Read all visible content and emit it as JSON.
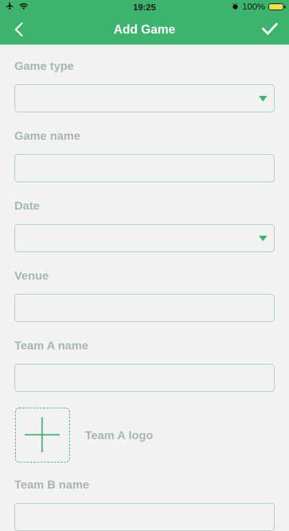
{
  "status_bar": {
    "time": "19:25",
    "battery": "100%"
  },
  "nav": {
    "title": "Add Game",
    "back_icon": "chevron-left-icon",
    "confirm_icon": "checkmark-icon"
  },
  "form": {
    "game_type": {
      "label": "Game type",
      "value": ""
    },
    "game_name": {
      "label": "Game name",
      "value": ""
    },
    "date": {
      "label": "Date",
      "value": ""
    },
    "venue": {
      "label": "Venue",
      "value": ""
    },
    "team_a_name": {
      "label": "Team A name",
      "value": ""
    },
    "team_a_logo": {
      "label": "Team A logo"
    },
    "team_b_name": {
      "label": "Team B name",
      "value": ""
    }
  },
  "colors": {
    "accent": "#3cb46e",
    "label": "#a6b7ad",
    "border": "#b3c7bb",
    "background": "#f2f2f2"
  }
}
